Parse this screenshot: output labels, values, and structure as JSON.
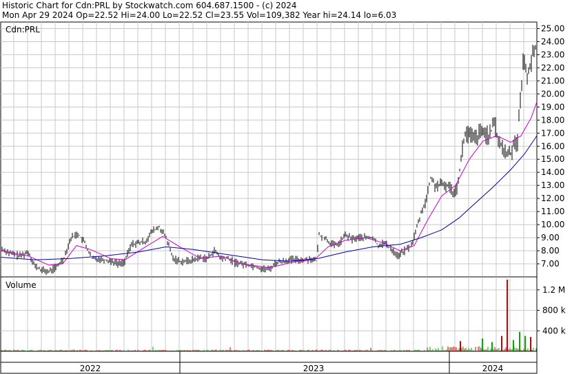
{
  "header": {
    "line1": "Historic Chart for Cdn:PRL by Stockwatch.com 604.687.1500 - (c) 2024",
    "line2": "Mon Apr 29 2024   Op=22.52   Hi=24.00   Lo=22.52   Cl=23.55   Vol=109,382   Year hi=24.14   lo=6.03"
  },
  "colors": {
    "price": "#000000",
    "ma_short": "#cc00cc",
    "ma_long": "#0000aa",
    "vol_up": "#00aa00",
    "vol_down": "#cc0000",
    "grid": "#c8c8c8"
  },
  "chart_data": [
    {
      "type": "line",
      "title": "Cdn:PRL",
      "ylim": [
        6.0,
        25.5
      ],
      "y_ticks": [
        "25.00",
        "24.00",
        "23.00",
        "22.00",
        "21.00",
        "20.00",
        "19.00",
        "18.00",
        "17.00",
        "16.00",
        "15.00",
        "14.00",
        "13.00",
        "12.00",
        "11.00",
        "10.00",
        "9.00",
        "8.00",
        "7.00"
      ],
      "x_labels": [
        "2022",
        "2023",
        "2024"
      ],
      "grid": true,
      "series": [
        {
          "key": "close",
          "values": [
            [
              0,
              8.2
            ],
            [
              14,
              7.8
            ],
            [
              28,
              7.6
            ],
            [
              40,
              7.9
            ],
            [
              50,
              6.8
            ],
            [
              60,
              6.5
            ],
            [
              70,
              6.4
            ],
            [
              82,
              6.8
            ],
            [
              92,
              7.5
            ],
            [
              102,
              9.0
            ],
            [
              112,
              9.3
            ],
            [
              122,
              8.6
            ],
            [
              132,
              7.4
            ],
            [
              142,
              7.4
            ],
            [
              152,
              7.3
            ],
            [
              162,
              7.2
            ],
            [
              172,
              7.0
            ],
            [
              180,
              7.2
            ],
            [
              190,
              8.5
            ],
            [
              200,
              8.6
            ],
            [
              210,
              8.7
            ],
            [
              220,
              9.5
            ],
            [
              230,
              9.8
            ],
            [
              240,
              9.0
            ],
            [
              250,
              7.4
            ],
            [
              260,
              7.2
            ],
            [
              270,
              7.2
            ],
            [
              280,
              7.3
            ],
            [
              290,
              7.5
            ],
            [
              300,
              7.4
            ],
            [
              310,
              8.0
            ],
            [
              320,
              7.4
            ],
            [
              330,
              7.4
            ],
            [
              340,
              7.1
            ],
            [
              350,
              7.0
            ],
            [
              360,
              6.9
            ],
            [
              370,
              6.8
            ],
            [
              380,
              6.6
            ],
            [
              390,
              6.6
            ],
            [
              400,
              7.1
            ],
            [
              410,
              7.2
            ],
            [
              420,
              7.3
            ],
            [
              430,
              7.3
            ],
            [
              440,
              7.3
            ],
            [
              450,
              7.4
            ],
            [
              458,
              7.2
            ],
            [
              462,
              9.2
            ],
            [
              470,
              9.0
            ],
            [
              478,
              8.6
            ],
            [
              485,
              8.4
            ],
            [
              492,
              8.6
            ],
            [
              500,
              9.2
            ],
            [
              510,
              8.9
            ],
            [
              520,
              9.0
            ],
            [
              530,
              9.0
            ],
            [
              540,
              9.0
            ],
            [
              548,
              8.4
            ],
            [
              556,
              8.6
            ],
            [
              566,
              8.2
            ],
            [
              576,
              7.6
            ],
            [
              586,
              8.0
            ],
            [
              596,
              8.4
            ],
            [
              604,
              9.8
            ],
            [
              612,
              11.2
            ],
            [
              618,
              12.0
            ],
            [
              624,
              13.6
            ],
            [
              630,
              13.0
            ],
            [
              640,
              13.0
            ],
            [
              650,
              13.0
            ],
            [
              656,
              12.5
            ],
            [
              662,
              12.8
            ],
            [
              668,
              15.0
            ],
            [
              674,
              17.0
            ],
            [
              680,
              16.8
            ],
            [
              688,
              16.5
            ],
            [
              696,
              17.0
            ],
            [
              704,
              17.0
            ],
            [
              710,
              16.8
            ],
            [
              716,
              17.8
            ],
            [
              722,
              16.5
            ],
            [
              728,
              15.8
            ],
            [
              734,
              15.4
            ],
            [
              740,
              15.5
            ],
            [
              746,
              16.4
            ],
            [
              750,
              16.5
            ],
            [
              754,
              19.5
            ],
            [
              758,
              22.5
            ],
            [
              764,
              21.5
            ],
            [
              770,
              22.5
            ],
            [
              775,
              23.5
            ],
            [
              778,
              23.55
            ]
          ]
        },
        {
          "key": "ma_short",
          "values": [
            [
              0,
              8.0
            ],
            [
              40,
              7.6
            ],
            [
              70,
              6.9
            ],
            [
              90,
              7.0
            ],
            [
              110,
              8.4
            ],
            [
              130,
              8.1
            ],
            [
              160,
              7.4
            ],
            [
              180,
              7.3
            ],
            [
              210,
              8.3
            ],
            [
              235,
              9.1
            ],
            [
              260,
              8.3
            ],
            [
              290,
              7.4
            ],
            [
              320,
              7.6
            ],
            [
              350,
              7.0
            ],
            [
              390,
              6.7
            ],
            [
              430,
              7.2
            ],
            [
              455,
              7.3
            ],
            [
              475,
              8.3
            ],
            [
              500,
              8.8
            ],
            [
              530,
              9.0
            ],
            [
              555,
              8.6
            ],
            [
              580,
              8.0
            ],
            [
              600,
              8.4
            ],
            [
              620,
              10.4
            ],
            [
              640,
              12.2
            ],
            [
              660,
              13.0
            ],
            [
              680,
              15.0
            ],
            [
              700,
              16.4
            ],
            [
              720,
              16.8
            ],
            [
              740,
              16.3
            ],
            [
              755,
              16.8
            ],
            [
              770,
              18.2
            ],
            [
              778,
              19.4
            ]
          ]
        },
        {
          "key": "ma_long",
          "values": [
            [
              0,
              7.5
            ],
            [
              50,
              7.3
            ],
            [
              100,
              7.4
            ],
            [
              150,
              7.6
            ],
            [
              200,
              7.9
            ],
            [
              240,
              8.3
            ],
            [
              280,
              8.1
            ],
            [
              330,
              7.7
            ],
            [
              380,
              7.3
            ],
            [
              420,
              7.2
            ],
            [
              460,
              7.4
            ],
            [
              500,
              7.9
            ],
            [
              540,
              8.3
            ],
            [
              580,
              8.5
            ],
            [
              610,
              9.0
            ],
            [
              640,
              9.6
            ],
            [
              665,
              10.5
            ],
            [
              690,
              11.7
            ],
            [
              715,
              12.9
            ],
            [
              740,
              14.2
            ],
            [
              760,
              15.4
            ],
            [
              778,
              16.8
            ]
          ]
        }
      ]
    },
    {
      "type": "bar",
      "title": "Volume",
      "ylim": [
        0,
        1400000
      ],
      "y_ticks": [
        "1.2 M",
        "800 k",
        "400 k"
      ],
      "y_tick_values": [
        1200000,
        800000,
        400000
      ],
      "spikes": [
        {
          "x": 736,
          "v": 1400000,
          "up": false
        },
        {
          "x": 728,
          "v": 300000,
          "up": false
        },
        {
          "x": 754,
          "v": 380000,
          "up": true
        },
        {
          "x": 762,
          "v": 300000,
          "up": true
        },
        {
          "x": 770,
          "v": 280000,
          "up": false
        },
        {
          "x": 700,
          "v": 250000,
          "up": true
        },
        {
          "x": 668,
          "v": 200000,
          "up": false
        },
        {
          "x": 714,
          "v": 180000,
          "up": true
        },
        {
          "x": 745,
          "v": 220000,
          "up": true
        }
      ]
    }
  ]
}
